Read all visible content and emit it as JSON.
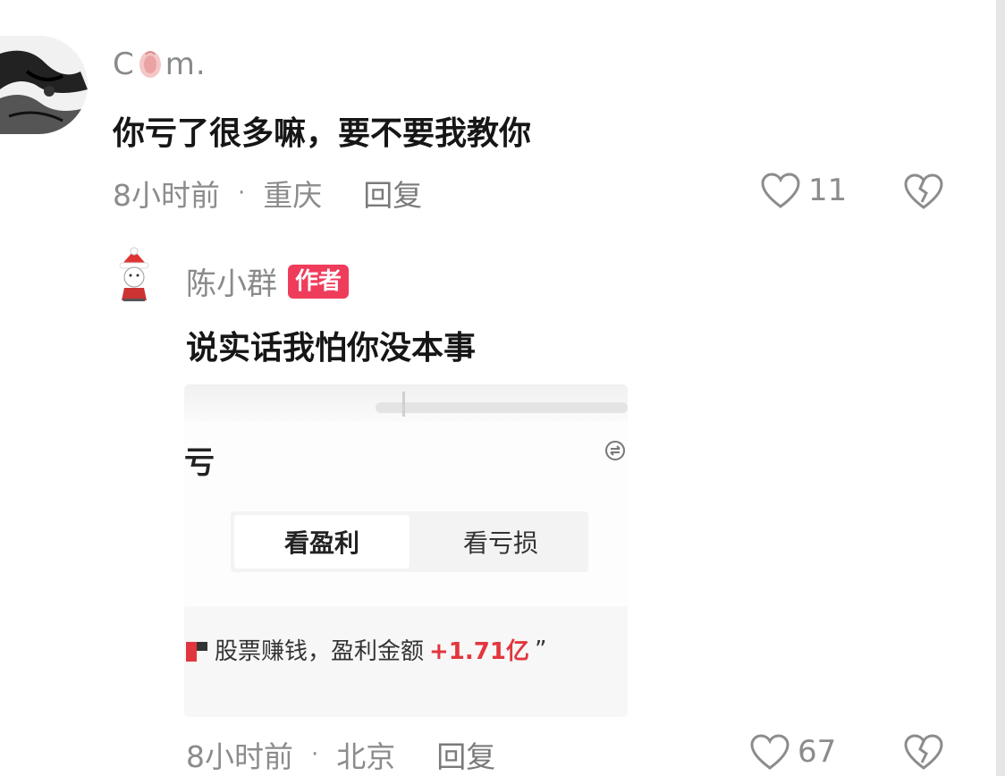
{
  "comment": {
    "user": {
      "name_start": "C",
      "name_end": "m."
    },
    "text": "你亏了很多嘛，要不要我教你",
    "time": "8小时前",
    "location": "重庆",
    "reply_label": "回复",
    "likes": "11"
  },
  "reply": {
    "user": {
      "name": "陈小群",
      "badge": "作者"
    },
    "text": "说实话我怕你没本事",
    "image": {
      "partial_title": "亏",
      "tabs": [
        {
          "label": "看盈利"
        },
        {
          "label": "看亏损"
        }
      ],
      "profit_text": "股票赚钱，盈利金额",
      "profit_value": "+1.71亿",
      "profit_quote": "”"
    },
    "time": "8小时前",
    "location": "北京",
    "reply_label": "回复",
    "likes": "67"
  },
  "colors": {
    "badge": "#ef3c5b",
    "profit": "#e2363e",
    "meta_text": "#8c8c8c"
  },
  "icons": [
    "heart-icon",
    "broken-heart-icon",
    "swap-icon",
    "flower-emoji"
  ]
}
